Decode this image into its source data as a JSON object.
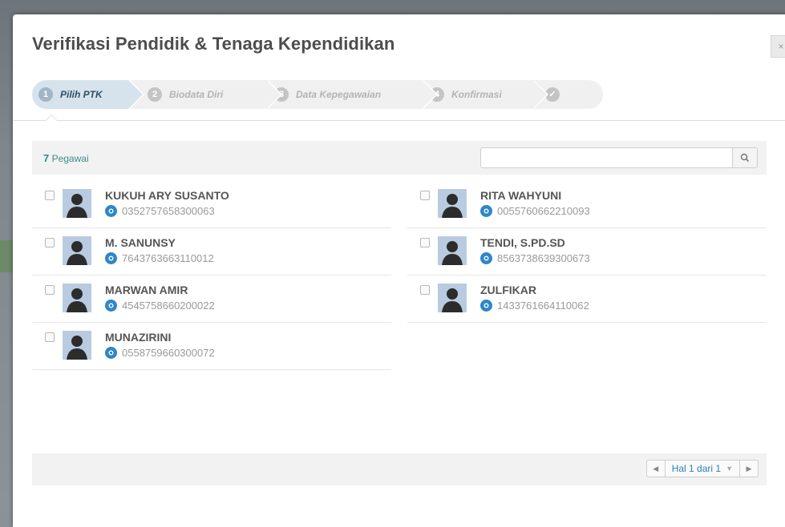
{
  "modal": {
    "title": "Verifikasi Pendidik & Tenaga Kependidikan",
    "close_label": "×"
  },
  "wizard": {
    "steps": [
      {
        "num": "1",
        "label": "Pilih PTK",
        "active": true
      },
      {
        "num": "2",
        "label": "Biodata Diri",
        "active": false
      },
      {
        "num": "3",
        "label": "Data Kepegawaian",
        "active": false
      },
      {
        "num": "4",
        "label": "Konfirmasi",
        "active": false
      },
      {
        "num": "✓",
        "label": "",
        "active": false
      }
    ]
  },
  "toolbar": {
    "count": "7",
    "count_label": "Pegawai",
    "search_value": "",
    "search_icon": "search-icon"
  },
  "employees": [
    {
      "name": "KUKUH ARY SUSANTO",
      "id": "0352757658300063",
      "checked": false
    },
    {
      "name": "RITA WAHYUNI",
      "id": "0055760662210093",
      "checked": false
    },
    {
      "name": "M. SANUNSY",
      "id": "7643763663110012",
      "checked": false
    },
    {
      "name": "TENDI, S.PD.SD",
      "id": "8563738639300673",
      "checked": false
    },
    {
      "name": "MARWAN AMIR",
      "id": "4545758660200022",
      "checked": false
    },
    {
      "name": "ZULFIKAR",
      "id": "1433761664110062",
      "checked": false
    },
    {
      "name": "MUNAZIRINI",
      "id": "0558759660300072",
      "checked": false
    }
  ],
  "pager": {
    "prev_icon": "caret-left-icon",
    "label": "Hal 1 dari 1",
    "next_icon": "caret-right-icon"
  },
  "colors": {
    "accent": "#2f8a80",
    "link": "#2f7fb5",
    "id_badge": "#2e86c9"
  }
}
